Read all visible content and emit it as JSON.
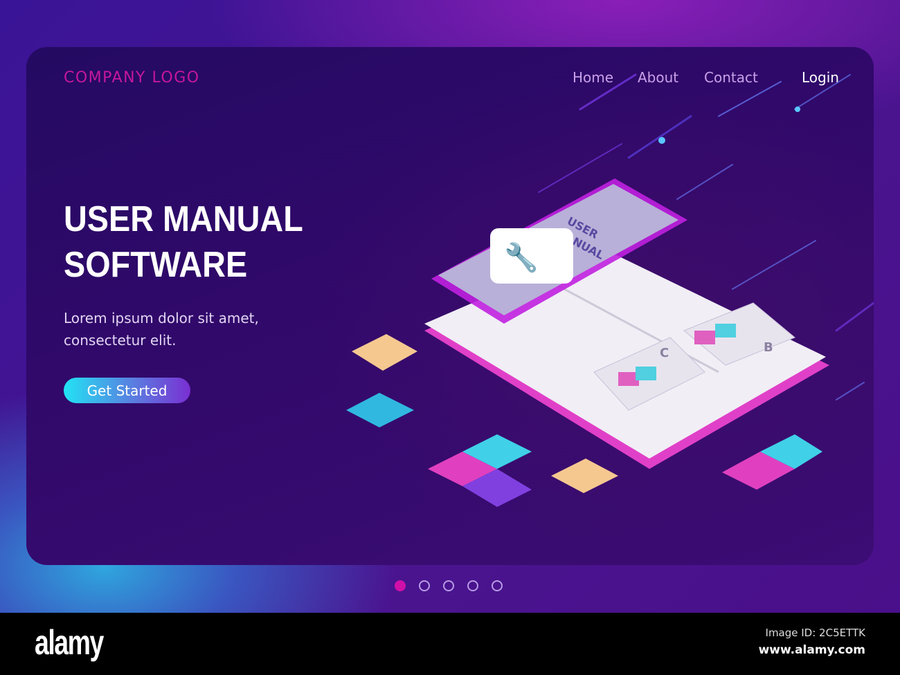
{
  "header": {
    "logo": "COMPANY LOGO",
    "nav": [
      "Home",
      "About",
      "Contact"
    ],
    "login": "Login"
  },
  "hero": {
    "title_line1": "USER MANUAL",
    "title_line2": "SOFTWARE",
    "subtitle_line1": "Lorem ipsum dolor sit amet,",
    "subtitle_line2": "consectetur elit.",
    "cta": "Get Started"
  },
  "illustration": {
    "phone_text_line1": "USER",
    "phone_text_line2": "MANUAL",
    "page_labels": [
      "C",
      "B"
    ]
  },
  "pagination": {
    "total": 5,
    "active": 1
  },
  "watermark": {
    "brand": "alamy",
    "image_id": "Image ID: 2C5ETTK",
    "url": "www.alamy.com"
  },
  "colors": {
    "accent": "#c6179c",
    "cta_start": "#22e3f4",
    "cta_end": "#7a2fd2",
    "background": "#30096a"
  }
}
